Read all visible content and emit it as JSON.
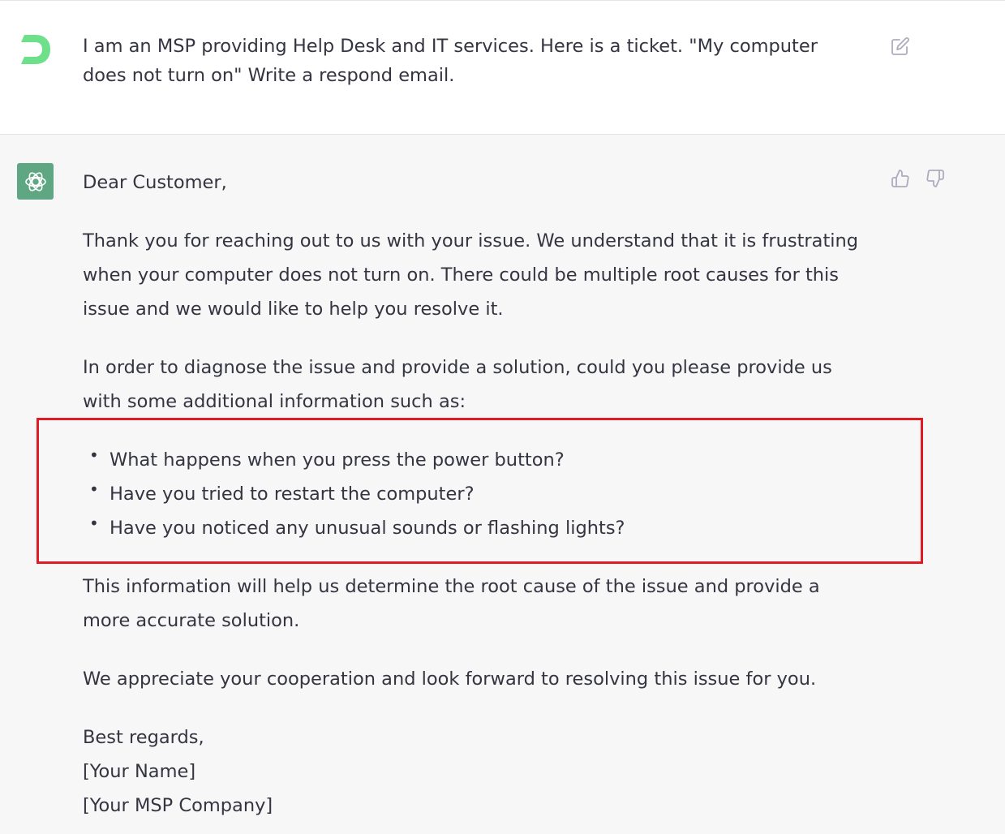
{
  "user_message": {
    "text": "I am an MSP providing Help Desk and IT services. Here is a ticket. \"My computer does not turn on\" Write a respond email.",
    "avatar_icon": "user-logo-icon",
    "edit_icon": "edit-icon"
  },
  "assistant_message": {
    "avatar_icon": "openai-logo-icon",
    "greeting": "Dear Customer,",
    "paragraph_1": "Thank you for reaching out to us with your issue. We understand that it is frustrating when your computer does not turn on. There could be multiple root causes for this issue and we would like to help you resolve it.",
    "paragraph_2": "In order to diagnose the issue and provide a solution, could you please provide us with some additional information such as:",
    "bullets": [
      "What happens when you press the power button?",
      "Have you tried to restart the computer?",
      "Have you noticed any unusual sounds or flashing lights?"
    ],
    "paragraph_3": "This information will help us determine the root cause of the issue and provide a more accurate solution.",
    "paragraph_4": "We appreciate your cooperation and look forward to resolving this issue for you.",
    "signoff": "Best regards,",
    "signature_name": "[Your Name]",
    "signature_company": "[Your MSP Company]",
    "feedback_icons": [
      "thumbs-up-icon",
      "thumbs-down-icon"
    ]
  },
  "colors": {
    "highlight_box": "#e01b24",
    "assistant_avatar": "#5fa782",
    "user_avatar": "#6ee08a",
    "assistant_bg": "#f7f7f8"
  }
}
